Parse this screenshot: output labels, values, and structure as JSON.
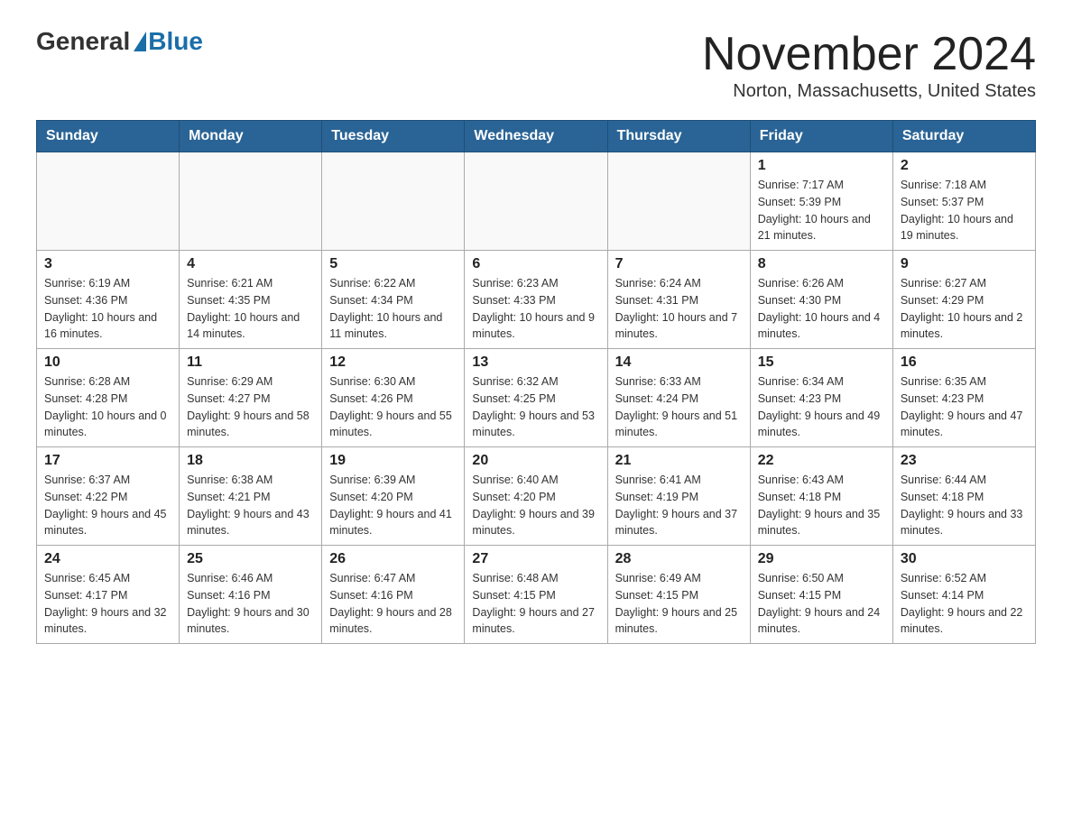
{
  "header": {
    "logo_general": "General",
    "logo_blue": "Blue",
    "month_title": "November 2024",
    "location": "Norton, Massachusetts, United States"
  },
  "days_of_week": [
    "Sunday",
    "Monday",
    "Tuesday",
    "Wednesday",
    "Thursday",
    "Friday",
    "Saturday"
  ],
  "weeks": [
    [
      {
        "day": "",
        "sunrise": "",
        "sunset": "",
        "daylight": ""
      },
      {
        "day": "",
        "sunrise": "",
        "sunset": "",
        "daylight": ""
      },
      {
        "day": "",
        "sunrise": "",
        "sunset": "",
        "daylight": ""
      },
      {
        "day": "",
        "sunrise": "",
        "sunset": "",
        "daylight": ""
      },
      {
        "day": "",
        "sunrise": "",
        "sunset": "",
        "daylight": ""
      },
      {
        "day": "1",
        "sunrise": "Sunrise: 7:17 AM",
        "sunset": "Sunset: 5:39 PM",
        "daylight": "Daylight: 10 hours and 21 minutes."
      },
      {
        "day": "2",
        "sunrise": "Sunrise: 7:18 AM",
        "sunset": "Sunset: 5:37 PM",
        "daylight": "Daylight: 10 hours and 19 minutes."
      }
    ],
    [
      {
        "day": "3",
        "sunrise": "Sunrise: 6:19 AM",
        "sunset": "Sunset: 4:36 PM",
        "daylight": "Daylight: 10 hours and 16 minutes."
      },
      {
        "day": "4",
        "sunrise": "Sunrise: 6:21 AM",
        "sunset": "Sunset: 4:35 PM",
        "daylight": "Daylight: 10 hours and 14 minutes."
      },
      {
        "day": "5",
        "sunrise": "Sunrise: 6:22 AM",
        "sunset": "Sunset: 4:34 PM",
        "daylight": "Daylight: 10 hours and 11 minutes."
      },
      {
        "day": "6",
        "sunrise": "Sunrise: 6:23 AM",
        "sunset": "Sunset: 4:33 PM",
        "daylight": "Daylight: 10 hours and 9 minutes."
      },
      {
        "day": "7",
        "sunrise": "Sunrise: 6:24 AM",
        "sunset": "Sunset: 4:31 PM",
        "daylight": "Daylight: 10 hours and 7 minutes."
      },
      {
        "day": "8",
        "sunrise": "Sunrise: 6:26 AM",
        "sunset": "Sunset: 4:30 PM",
        "daylight": "Daylight: 10 hours and 4 minutes."
      },
      {
        "day": "9",
        "sunrise": "Sunrise: 6:27 AM",
        "sunset": "Sunset: 4:29 PM",
        "daylight": "Daylight: 10 hours and 2 minutes."
      }
    ],
    [
      {
        "day": "10",
        "sunrise": "Sunrise: 6:28 AM",
        "sunset": "Sunset: 4:28 PM",
        "daylight": "Daylight: 10 hours and 0 minutes."
      },
      {
        "day": "11",
        "sunrise": "Sunrise: 6:29 AM",
        "sunset": "Sunset: 4:27 PM",
        "daylight": "Daylight: 9 hours and 58 minutes."
      },
      {
        "day": "12",
        "sunrise": "Sunrise: 6:30 AM",
        "sunset": "Sunset: 4:26 PM",
        "daylight": "Daylight: 9 hours and 55 minutes."
      },
      {
        "day": "13",
        "sunrise": "Sunrise: 6:32 AM",
        "sunset": "Sunset: 4:25 PM",
        "daylight": "Daylight: 9 hours and 53 minutes."
      },
      {
        "day": "14",
        "sunrise": "Sunrise: 6:33 AM",
        "sunset": "Sunset: 4:24 PM",
        "daylight": "Daylight: 9 hours and 51 minutes."
      },
      {
        "day": "15",
        "sunrise": "Sunrise: 6:34 AM",
        "sunset": "Sunset: 4:23 PM",
        "daylight": "Daylight: 9 hours and 49 minutes."
      },
      {
        "day": "16",
        "sunrise": "Sunrise: 6:35 AM",
        "sunset": "Sunset: 4:23 PM",
        "daylight": "Daylight: 9 hours and 47 minutes."
      }
    ],
    [
      {
        "day": "17",
        "sunrise": "Sunrise: 6:37 AM",
        "sunset": "Sunset: 4:22 PM",
        "daylight": "Daylight: 9 hours and 45 minutes."
      },
      {
        "day": "18",
        "sunrise": "Sunrise: 6:38 AM",
        "sunset": "Sunset: 4:21 PM",
        "daylight": "Daylight: 9 hours and 43 minutes."
      },
      {
        "day": "19",
        "sunrise": "Sunrise: 6:39 AM",
        "sunset": "Sunset: 4:20 PM",
        "daylight": "Daylight: 9 hours and 41 minutes."
      },
      {
        "day": "20",
        "sunrise": "Sunrise: 6:40 AM",
        "sunset": "Sunset: 4:20 PM",
        "daylight": "Daylight: 9 hours and 39 minutes."
      },
      {
        "day": "21",
        "sunrise": "Sunrise: 6:41 AM",
        "sunset": "Sunset: 4:19 PM",
        "daylight": "Daylight: 9 hours and 37 minutes."
      },
      {
        "day": "22",
        "sunrise": "Sunrise: 6:43 AM",
        "sunset": "Sunset: 4:18 PM",
        "daylight": "Daylight: 9 hours and 35 minutes."
      },
      {
        "day": "23",
        "sunrise": "Sunrise: 6:44 AM",
        "sunset": "Sunset: 4:18 PM",
        "daylight": "Daylight: 9 hours and 33 minutes."
      }
    ],
    [
      {
        "day": "24",
        "sunrise": "Sunrise: 6:45 AM",
        "sunset": "Sunset: 4:17 PM",
        "daylight": "Daylight: 9 hours and 32 minutes."
      },
      {
        "day": "25",
        "sunrise": "Sunrise: 6:46 AM",
        "sunset": "Sunset: 4:16 PM",
        "daylight": "Daylight: 9 hours and 30 minutes."
      },
      {
        "day": "26",
        "sunrise": "Sunrise: 6:47 AM",
        "sunset": "Sunset: 4:16 PM",
        "daylight": "Daylight: 9 hours and 28 minutes."
      },
      {
        "day": "27",
        "sunrise": "Sunrise: 6:48 AM",
        "sunset": "Sunset: 4:15 PM",
        "daylight": "Daylight: 9 hours and 27 minutes."
      },
      {
        "day": "28",
        "sunrise": "Sunrise: 6:49 AM",
        "sunset": "Sunset: 4:15 PM",
        "daylight": "Daylight: 9 hours and 25 minutes."
      },
      {
        "day": "29",
        "sunrise": "Sunrise: 6:50 AM",
        "sunset": "Sunset: 4:15 PM",
        "daylight": "Daylight: 9 hours and 24 minutes."
      },
      {
        "day": "30",
        "sunrise": "Sunrise: 6:52 AM",
        "sunset": "Sunset: 4:14 PM",
        "daylight": "Daylight: 9 hours and 22 minutes."
      }
    ]
  ]
}
